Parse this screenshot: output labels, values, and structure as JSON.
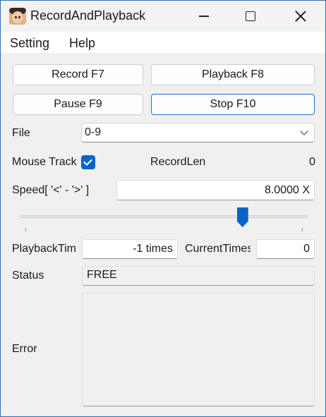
{
  "window": {
    "title": "RecordAndPlayback"
  },
  "menu": {
    "setting": "Setting",
    "help": "Help"
  },
  "buttons": {
    "record": "Record F7",
    "playback": "Playback F8",
    "pause": "Pause F9",
    "stop": "Stop F10"
  },
  "file": {
    "label": "File",
    "selected": "0-9"
  },
  "mouse_track": {
    "label": "Mouse Track",
    "checked": true
  },
  "record_len": {
    "label": "RecordLen",
    "value": "0"
  },
  "speed": {
    "label": "Speed[ '<' - '>' ]",
    "value": "8.0000 X",
    "slider_fraction": 0.785
  },
  "playback_times": {
    "label": "PlaybackTim",
    "value": "-1 times"
  },
  "current_times": {
    "label": "CurrentTimes",
    "value": "0"
  },
  "status": {
    "label": "Status",
    "value": "FREE"
  },
  "error": {
    "label": "Error",
    "value": ""
  },
  "colors": {
    "accent": "#0a63c9",
    "focus_border": "#2a6cc4",
    "window_border": "#2c6fb3"
  },
  "icons": {
    "app": "face-avatar-icon",
    "minimize": "minimize-icon",
    "maximize": "maximize-icon",
    "close": "close-icon",
    "dropdown": "chevron-down-icon",
    "check": "checkmark-icon"
  }
}
